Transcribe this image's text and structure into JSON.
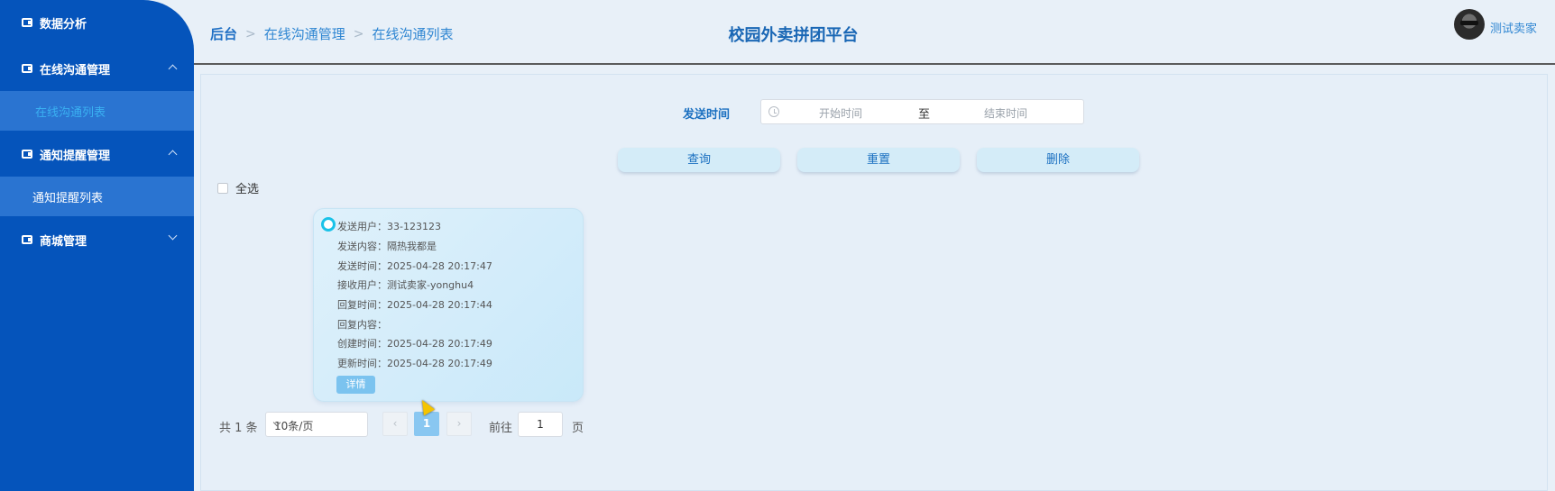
{
  "sidebar": {
    "items": [
      {
        "label": "数据分析"
      },
      {
        "label": "在线沟通管理",
        "sub": "在线沟通列表"
      },
      {
        "label": "通知提醒管理",
        "sub": "通知提醒列表"
      },
      {
        "label": "商城管理"
      }
    ]
  },
  "header": {
    "breadcrumb": [
      "后台",
      "在线沟通管理",
      "在线沟通列表"
    ],
    "title": "校园外卖拼团平台",
    "username": "测试卖家"
  },
  "search": {
    "label": "发送时间",
    "start_placeholder": "开始时间",
    "to": "至",
    "end_placeholder": "结束时间"
  },
  "buttons": {
    "query": "查询",
    "reset": "重置",
    "delete": "删除"
  },
  "select_all": "全选",
  "card": {
    "rows": [
      {
        "k": "发送用户：",
        "v": "33-123123"
      },
      {
        "k": "发送内容：",
        "v": "隔热我都是"
      },
      {
        "k": "发送时间：",
        "v": "2025-04-28 20:17:47"
      },
      {
        "k": "接收用户：",
        "v": "测试卖家-yonghu4"
      },
      {
        "k": "回复时间：",
        "v": "2025-04-28 20:17:44"
      },
      {
        "k": "回复内容：",
        "v": ""
      },
      {
        "k": "创建时间：",
        "v": "2025-04-28 20:17:49"
      },
      {
        "k": "更新时间：",
        "v": "2025-04-28 20:17:49"
      }
    ],
    "detail_label": "详情"
  },
  "pagination": {
    "total": "共 1 条",
    "page_size": "10条/页",
    "prev": "‹",
    "current": "1",
    "next": "›",
    "goto_label": "前往",
    "goto_value": "1",
    "page_word": "页"
  }
}
